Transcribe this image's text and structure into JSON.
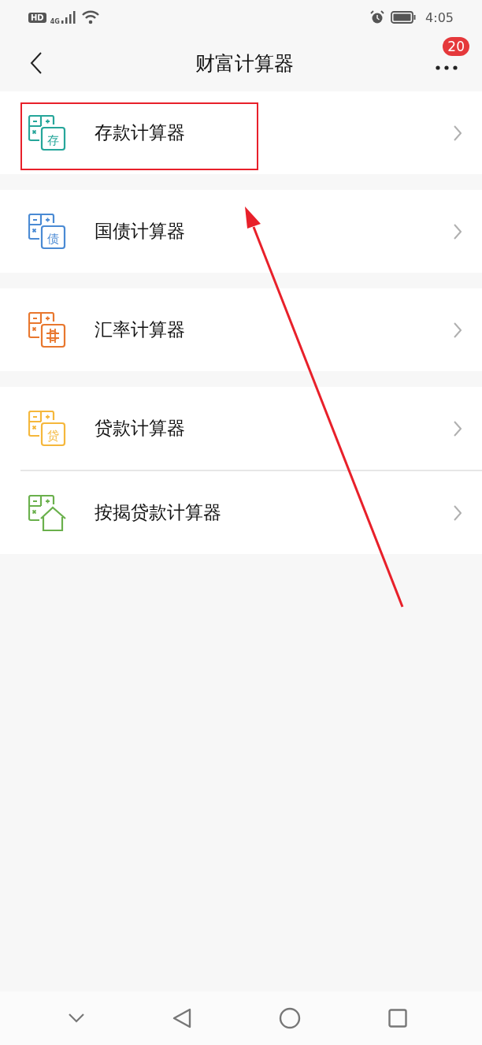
{
  "status_bar": {
    "hd": "HD",
    "network": "4G",
    "time": "4:05"
  },
  "header": {
    "title": "财富计算器",
    "badge": "20"
  },
  "groups": [
    {
      "items": [
        {
          "label": "存款计算器",
          "kind": "glyph",
          "glyph": "存",
          "color": "#26a69a",
          "highlighted": true
        }
      ]
    },
    {
      "items": [
        {
          "label": "国债计算器",
          "kind": "glyph",
          "glyph": "债",
          "color": "#4a8ad4",
          "highlighted": false
        }
      ]
    },
    {
      "items": [
        {
          "label": "汇率计算器",
          "kind": "currency",
          "color": "#e8772e",
          "highlighted": false
        }
      ]
    },
    {
      "items": [
        {
          "label": "贷款计算器",
          "kind": "glyph",
          "glyph": "贷",
          "color": "#f5b73b",
          "highlighted": false
        },
        {
          "label": "按揭贷款计算器",
          "kind": "house",
          "color": "#6ab04c",
          "highlighted": false
        }
      ]
    }
  ],
  "pointer_arrow": true
}
